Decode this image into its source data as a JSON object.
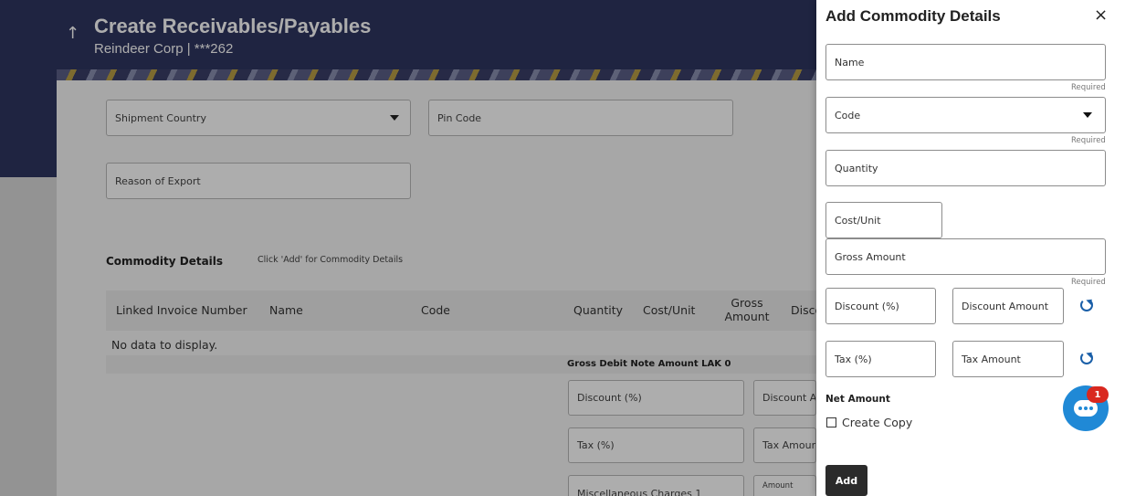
{
  "header": {
    "title": "Create Receivables/Payables",
    "subtitle": "Reindeer Corp | ***262",
    "back_icon": "↑"
  },
  "form": {
    "shipment_country": "Shipment Country",
    "pin_code": "Pin Code",
    "reason_of_export": "Reason of Export"
  },
  "commodity": {
    "title": "Commodity Details",
    "hint": "Click 'Add' for Commodity Details",
    "columns": {
      "linked_invoice": "Linked Invoice Number",
      "name": "Name",
      "code": "Code",
      "quantity": "Quantity",
      "cost_unit": "Cost/Unit",
      "gross_amount": "Gross Amount",
      "discount": "Disco"
    },
    "no_data": "No data to display."
  },
  "summary": {
    "gross_debit": "Gross Debit Note Amount   LAK 0",
    "discount_pct": "Discount (%)",
    "discount_amount": "Discount An",
    "tax_pct": "Tax (%)",
    "tax_amount": "Tax Amount",
    "misc_charges": "Miscellaneous Charges 1",
    "amount": "Amount"
  },
  "drawer": {
    "title": "Add Commodity Details",
    "close": "×",
    "name_placeholder": "Name",
    "required": "Required",
    "code_placeholder": "Code",
    "quantity_placeholder": "Quantity",
    "cost_unit_placeholder": "Cost/Unit",
    "gross_amount_placeholder": "Gross Amount",
    "discount_pct_placeholder": "Discount (%)",
    "discount_amount_placeholder": "Discount Amount",
    "tax_pct_placeholder": "Tax (%)",
    "tax_amount_placeholder": "Tax Amount",
    "net_amount_label": "Net Amount",
    "create_copy_label": "Create Copy",
    "add_button": "Add"
  },
  "chat": {
    "badge_count": "1"
  },
  "colors": {
    "header_bg": "#2f3560",
    "accent_blue": "#1a5fa8",
    "chat_blue": "#2089d6",
    "badge_red": "#d9281f",
    "add_button_bg": "#2b2b2b"
  }
}
